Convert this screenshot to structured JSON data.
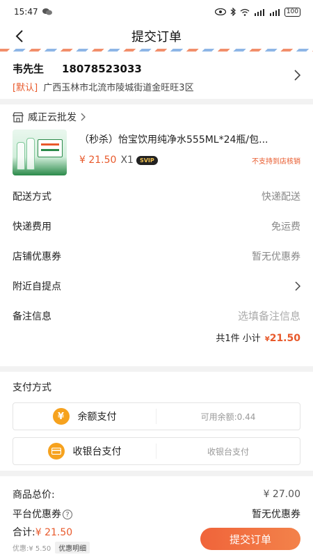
{
  "status_bar": {
    "time": "15:47",
    "battery": "100"
  },
  "nav": {
    "title": "提交订单"
  },
  "address": {
    "name": "韦先生",
    "phone": "18078523033",
    "default_tag": "[默认]",
    "detail": "广西玉林市北流市陵城街道金旺旺3区"
  },
  "shop": {
    "name": "威正云批发",
    "product": {
      "title": "（秒杀）怡宝饮用纯净水555ML*24瓶/包...",
      "price": "¥ 21.50",
      "quantity": "X1",
      "badge": "SVIP",
      "pickup_note": "不支持到店核销"
    },
    "rows": [
      {
        "label": "配送方式",
        "value": "快递配送"
      },
      {
        "label": "快递费用",
        "value": "免运费"
      },
      {
        "label": "店铺优惠券",
        "value": "暂无优惠券"
      },
      {
        "label": "附近自提点",
        "value": ""
      },
      {
        "label": "备注信息",
        "value": ""
      }
    ],
    "remark_placeholder": "选填备注信息",
    "subtotal": {
      "label": "共1件 小计",
      "currency": "¥",
      "amount": "21.50"
    }
  },
  "payment": {
    "title": "支付方式",
    "options": [
      {
        "label": "余额支付",
        "info": "可用余额:0.44",
        "icon": "yen-icon"
      },
      {
        "label": "收银台支付",
        "info": "收银台支付",
        "icon": "card-icon"
      }
    ]
  },
  "summary": {
    "goods_total_label": "商品总价:",
    "goods_total_value": "¥ 27.00",
    "platform_coupon_label": "平台优惠券",
    "platform_coupon_value": "暂无优惠券",
    "total_label": "合计:",
    "total_amount": "¥ 21.50",
    "discount_label": "优惠:¥ 5.50",
    "discount_detail": "优惠明细",
    "submit_label": "提交订单"
  },
  "colors": {
    "accent": "#e8592b",
    "pay_icon": "#f6a21e"
  }
}
